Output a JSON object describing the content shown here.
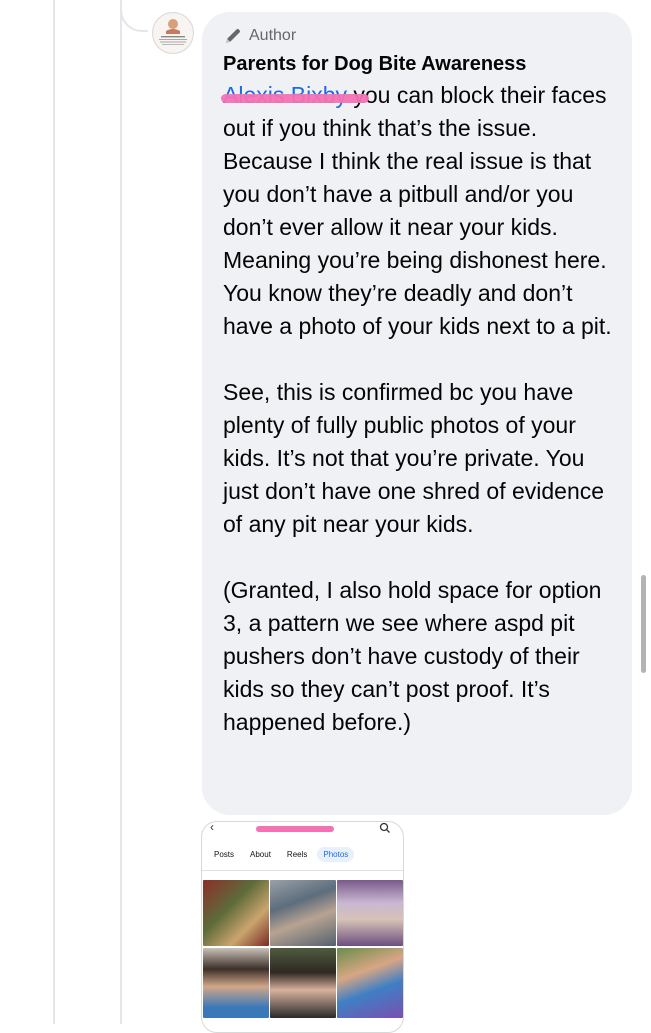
{
  "comment": {
    "badge": "Author",
    "author": "Parents for Dog Bite Awareness",
    "mention": "Alexis Bixby",
    "paragraphs": [
      " you can block their faces out if you think that’s the issue. Because I think the real issue is that you don’t have a pitbull and/or you don’t ever allow it near your kids. Meaning you’re being dishonest here. You know they’re deadly and don’t have a photo of your kids next to a pit.",
      "See, this is confirmed bc you have plenty of fully public photos of your kids. It’s not that you’re private. You just don’t have one shred of evidence of any pit near your kids.",
      "(Granted, I also hold space for option 3, a pattern we see where aspd pit pushers don’t have custody of their kids so they can’t post proof. It’s happened before.)"
    ]
  },
  "attachment": {
    "back_icon": "chevron-left-icon",
    "search_icon": "search-icon",
    "tabs": [
      "Posts",
      "About",
      "Reels",
      "Photos"
    ],
    "active_tab": "Photos"
  },
  "colors": {
    "bubble": "#f0f1f4",
    "link": "#1d6ae5",
    "redaction": "#f472b4",
    "meta": "#65676b"
  }
}
